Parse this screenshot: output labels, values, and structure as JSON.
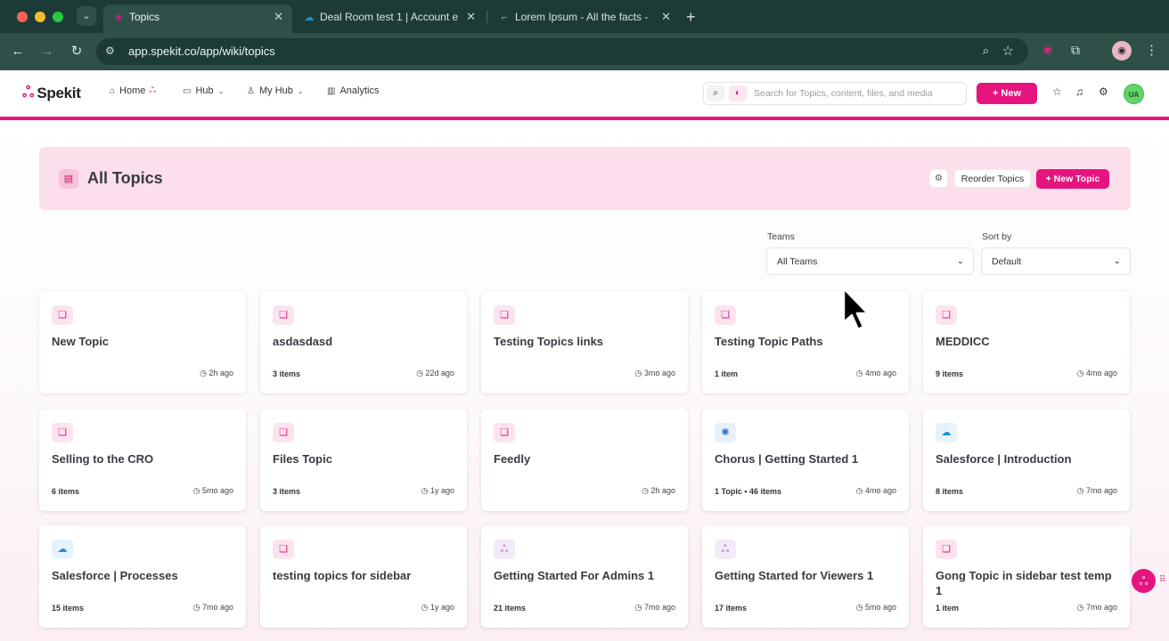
{
  "browser": {
    "tabs": [
      {
        "title": "Topics",
        "favicon": "spekit-icon",
        "active": true
      },
      {
        "title": "Deal Room test 1 | Account e",
        "favicon": "salesforce-cloud-icon",
        "active": false
      },
      {
        "title": "Lorem Ipsum - All the facts -",
        "favicon": "page-icon",
        "active": false
      }
    ],
    "url": "app.spekit.co/app/wiki/topics"
  },
  "header": {
    "logo_text": "Spekit",
    "nav": {
      "home": "Home",
      "hub": "Hub",
      "my_hub": "My Hub",
      "analytics": "Analytics"
    },
    "search_placeholder": "Search for Topics, content, files, and media",
    "new_button": "+ New",
    "avatar_initials": "UA"
  },
  "hero": {
    "title": "All Topics",
    "reorder_button": "Reorder Topics",
    "new_topic_button": "+ New Topic"
  },
  "filters": {
    "teams_label": "Teams",
    "teams_value": "All Teams",
    "sort_label": "Sort by",
    "sort_value": "Default"
  },
  "topics": [
    {
      "title": "New Topic",
      "count": "",
      "time": "2h ago",
      "icon": "bookmark-icon"
    },
    {
      "title": "asdasdasd",
      "count": "3 items",
      "time": "22d ago",
      "icon": "bookmark-icon"
    },
    {
      "title": "Testing Topics links",
      "count": "",
      "time": "3mo ago",
      "icon": "bookmark-icon"
    },
    {
      "title": "Testing Topic Paths",
      "count": "1 item",
      "time": "4mo ago",
      "icon": "bookmark-icon"
    },
    {
      "title": "MEDDICC",
      "count": "9 items",
      "time": "4mo ago",
      "icon": "bookmark-icon"
    },
    {
      "title": "Selling to the CRO",
      "count": "6 items",
      "time": "5mo ago",
      "icon": "bookmark-icon"
    },
    {
      "title": "Files Topic",
      "count": "3 items",
      "time": "1y ago",
      "icon": "bookmark-icon"
    },
    {
      "title": "Feedly",
      "count": "",
      "time": "2h ago",
      "icon": "bookmark-icon"
    },
    {
      "title": "Chorus | Getting Started 1",
      "count": "1 Topic  •  46 items",
      "time": "4mo ago",
      "icon": "chorus-icon"
    },
    {
      "title": "Salesforce | Introduction",
      "count": "8 items",
      "time": "7mo ago",
      "icon": "salesforce-cloud-icon"
    },
    {
      "title": "Salesforce | Processes",
      "count": "15 items",
      "time": "7mo ago",
      "icon": "salesforce-cloud-icon"
    },
    {
      "title": "testing topics for sidebar",
      "count": "",
      "time": "1y ago",
      "icon": "bookmark-icon"
    },
    {
      "title": "Getting Started For Admins 1",
      "count": "21 items",
      "time": "7mo ago",
      "icon": "spekit-octopus-icon"
    },
    {
      "title": "Getting Started for Viewers 1",
      "count": "17 items",
      "time": "5mo ago",
      "icon": "spekit-octopus-icon"
    },
    {
      "title": "Gong Topic in sidebar test temp 1",
      "count": "1 item",
      "time": "7mo ago",
      "icon": "bookmark-icon"
    }
  ],
  "colors": {
    "brand": "#e5147f",
    "hero_bg": "#fbdfec",
    "chrome": "#1d3b36"
  }
}
